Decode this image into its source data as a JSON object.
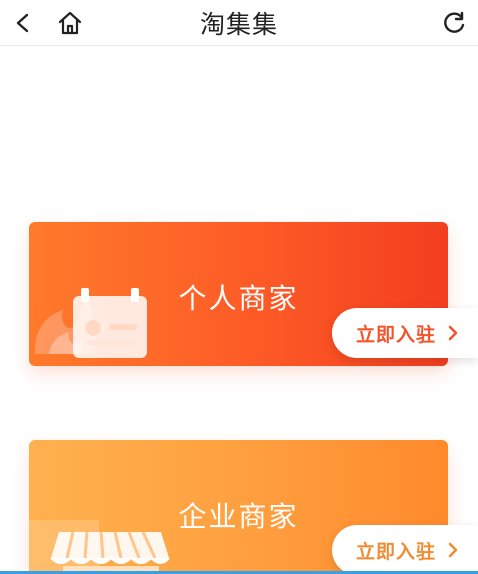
{
  "header": {
    "title": "淘集集",
    "back_icon": "chevron-left-icon",
    "home_icon": "home-icon",
    "refresh_icon": "refresh-icon"
  },
  "cards": {
    "personal": {
      "title": "个人商家",
      "join_label": "立即入驻",
      "color": "#f2552a"
    },
    "enterprise": {
      "title": "企业商家",
      "join_label": "立即入驻",
      "color": "#f08d34"
    }
  }
}
